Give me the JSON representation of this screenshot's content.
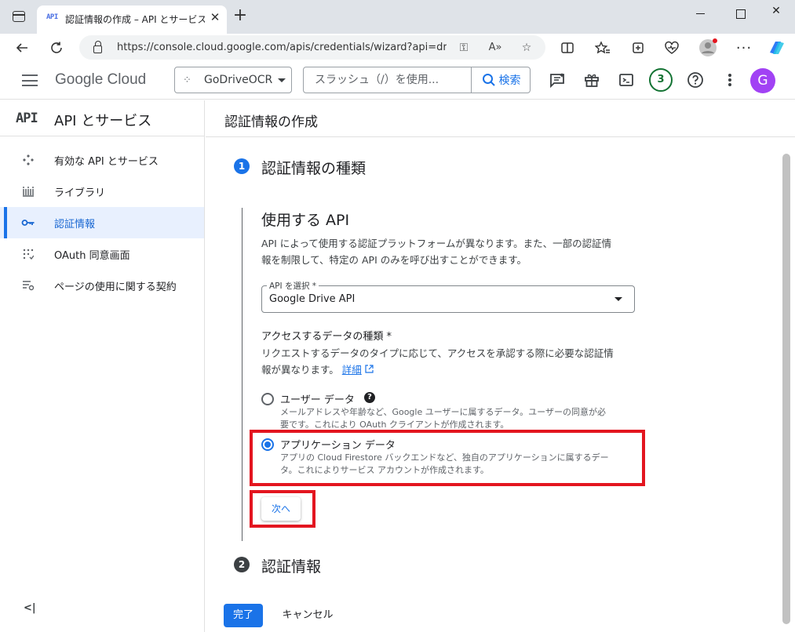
{
  "browser": {
    "tab_favicon": "API",
    "tab_title": "認証情報の作成 – API とサービス – G",
    "url": "https://console.cloud.google.com/apis/credentials/wizard?api=dri..."
  },
  "gcp": {
    "logo_google": "Google",
    "logo_cloud": " Cloud",
    "project_name": "GoDriveOCR",
    "search_placeholder": "スラッシュ（/）を使用...",
    "search_button": "検索",
    "notifications_count": "3",
    "avatar_initial": "G"
  },
  "sidebar": {
    "logo": "API",
    "title": "API とサービス",
    "items": [
      {
        "label": "有効な API とサービス",
        "icon": "api-hub-icon"
      },
      {
        "label": "ライブラリ",
        "icon": "library-icon"
      },
      {
        "label": "認証情報",
        "icon": "key-icon"
      },
      {
        "label": "OAuth 同意画面",
        "icon": "oauth-consent-icon"
      },
      {
        "label": "ページの使用に関する契約",
        "icon": "settings-list-icon"
      }
    ],
    "active_item": "認証情報",
    "collapse": "<|"
  },
  "main": {
    "page_title": "認証情報の作成",
    "step1": {
      "number": "1",
      "title": "認証情報の種類"
    },
    "section_title": "使用する API",
    "section_desc_line1": "API によって使用する認証プラットフォームが異なります。また、一部の認証情",
    "section_desc_line2": "報を制限して、特定の API のみを呼び出すことができます。",
    "api_select_label": "API を選択 *",
    "api_select_value": "Google Drive API",
    "data_type_label": "アクセスするデータの種類 *",
    "data_type_desc_line1": "リクエストするデータのタイプに応じて、アクセスを承認する際に必要な認証情",
    "data_type_desc_line2": "報が異なります。",
    "details_link": "詳細",
    "options": [
      {
        "label": "ユーザー データ",
        "desc_line1": "メールアドレスや年齢など、Google ユーザーに属するデータ。ユーザーの同意が必",
        "desc_line2": "要です。これにより OAuth クライアントが作成されます。",
        "checked": false
      },
      {
        "label": "アプリケーション データ",
        "desc_line1": "アプリの Cloud Firestore バックエンドなど、独自のアプリケーションに属するデー",
        "desc_line2": "タ。これによりサービス アカウントが作成されます。",
        "checked": true
      }
    ],
    "next_button": "次へ",
    "step2": {
      "number": "2",
      "title": "認証情報"
    },
    "done_button": "完了",
    "cancel_button": "キャンセル"
  },
  "colors": {
    "accent": "#1a73e8",
    "highlight": "#e3151f"
  }
}
